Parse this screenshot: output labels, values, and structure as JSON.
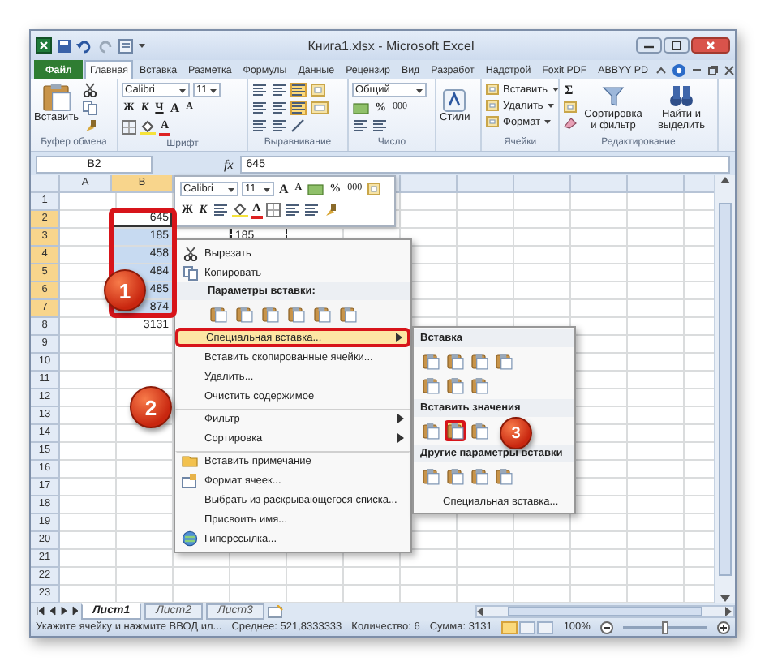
{
  "window": {
    "title": "Книга1.xlsx - Microsoft Excel"
  },
  "ribbon_tabs": [
    {
      "label": "Файл",
      "kind": "file",
      "selected": false
    },
    {
      "label": "Главная",
      "kind": "tab",
      "selected": true
    },
    {
      "label": "Вставка",
      "kind": "tab",
      "selected": false
    },
    {
      "label": "Разметка",
      "kind": "tab",
      "selected": false
    },
    {
      "label": "Формулы",
      "kind": "tab",
      "selected": false
    },
    {
      "label": "Данные",
      "kind": "tab",
      "selected": false
    },
    {
      "label": "Рецензир",
      "kind": "tab",
      "selected": false
    },
    {
      "label": "Вид",
      "kind": "tab",
      "selected": false
    },
    {
      "label": "Разработ",
      "kind": "tab",
      "selected": false
    },
    {
      "label": "Надстрой",
      "kind": "tab",
      "selected": false
    },
    {
      "label": "Foxit PDF",
      "kind": "tab",
      "selected": false
    },
    {
      "label": "ABBYY PD",
      "kind": "tab",
      "selected": false
    }
  ],
  "ribbon_groups": [
    {
      "kind": "clipboard",
      "label": "Буфер обмена",
      "paste_label": "Вставить"
    },
    {
      "kind": "font",
      "label": "Шрифт",
      "font": "Calibri",
      "size": "11",
      "style_buttons": [
        "Ж",
        "К",
        "Ч"
      ],
      "size_buttons": [
        "A",
        "A"
      ],
      "color_button": "A"
    },
    {
      "kind": "alignment",
      "label": "Выравнивание",
      "align_buttons": [
        {
          "selected": false
        },
        {
          "selected": false
        },
        {
          "selected": true
        },
        {
          "selected": false
        },
        {
          "selected": false
        },
        {
          "selected": true
        }
      ]
    },
    {
      "kind": "number",
      "label": "Число",
      "format": "Общий",
      "percent": "%",
      "thousands": "000"
    },
    {
      "kind": "styles",
      "button_label": "Стили"
    },
    {
      "kind": "cells",
      "label": "Ячейки",
      "buttons": [
        "Вставить",
        "Удалить",
        "Формат"
      ]
    },
    {
      "kind": "editing",
      "label": "Редактирование",
      "sigma": "Σ",
      "buttons": [
        "Сортировка и фильтр",
        "Найти и выделить"
      ]
    }
  ],
  "formula_bar": {
    "name_box": "B2",
    "function_label": "fx",
    "value": "645"
  },
  "column_headers": [
    {
      "label": "A",
      "selected": false
    },
    {
      "label": "B",
      "selected": true
    }
  ],
  "rows": [
    {
      "label": "1",
      "selected": false,
      "active": false
    },
    {
      "label": "2",
      "selected": true,
      "active": true,
      "column_b": "645"
    },
    {
      "label": "3",
      "selected": true,
      "active": false,
      "column_b": "185",
      "column_d": {
        "value": "185",
        "copied": true
      }
    },
    {
      "label": "4",
      "selected": true,
      "active": false,
      "column_b": "458"
    },
    {
      "label": "5",
      "selected": true,
      "active": false,
      "column_b": "484"
    },
    {
      "label": "6",
      "selected": true,
      "active": false,
      "column_b": "485"
    },
    {
      "label": "7",
      "selected": true,
      "active": false,
      "column_b": "874"
    },
    {
      "label": "8",
      "selected": false,
      "active": false,
      "column_b": "3131"
    },
    {
      "label": "9",
      "selected": false,
      "active": false
    },
    {
      "label": "10",
      "selected": false,
      "active": false
    },
    {
      "label": "11",
      "selected": false,
      "active": false
    },
    {
      "label": "12",
      "selected": false,
      "active": false
    },
    {
      "label": "13",
      "selected": false,
      "active": false
    },
    {
      "label": "14",
      "selected": false,
      "active": false
    },
    {
      "label": "15",
      "selected": false,
      "active": false
    },
    {
      "label": "16",
      "selected": false,
      "active": false
    },
    {
      "label": "17",
      "selected": false,
      "active": false
    },
    {
      "label": "18",
      "selected": false,
      "active": false
    },
    {
      "label": "19",
      "selected": false,
      "active": false
    },
    {
      "label": "20",
      "selected": false,
      "active": false
    },
    {
      "label": "21",
      "selected": false,
      "active": false
    },
    {
      "label": "22",
      "selected": false,
      "active": false
    },
    {
      "label": "23",
      "selected": false,
      "active": false
    }
  ],
  "sheet_tabs": [
    {
      "label": "Лист1",
      "selected": true
    },
    {
      "label": "Лист2",
      "selected": false
    },
    {
      "label": "Лист3",
      "selected": false
    }
  ],
  "status_bar": {
    "message": "Укажите ячейку и нажмите ВВОД ил...",
    "average": "Среднее: 521,8333333",
    "count": "Количество: 6",
    "sum": "Сумма: 3131",
    "views": [
      {
        "selected": true
      },
      {
        "selected": false
      },
      {
        "selected": false
      }
    ],
    "zoom": "100%",
    "zoom_slider": {
      "level": 0.5
    }
  },
  "mini_toolbar": {
    "font": "Calibri",
    "size": "11",
    "size_buttons": [
      "A",
      "A"
    ],
    "percent": "%",
    "thousands": "000",
    "style_buttons": [
      "Ж",
      "К"
    ],
    "color_button": "A"
  },
  "context_menu": {
    "items": [
      {
        "kind": "cut",
        "label": "Вырезать",
        "selected": false,
        "submenu": false,
        "separator_before": false
      },
      {
        "kind": "copy",
        "label": "Копировать",
        "selected": false,
        "submenu": false,
        "separator_before": false
      },
      {
        "kind": "header",
        "label": "Параметры вставки:",
        "selected": false,
        "submenu": false,
        "separator_before": false
      },
      {
        "kind": "paste_options",
        "selected": false,
        "submenu": false,
        "separator_before": false
      },
      {
        "kind": "plain",
        "label": "Специальная вставка...",
        "selected": true,
        "submenu": true,
        "separator_before": false
      },
      {
        "kind": "plain",
        "label": "Вставить скопированные ячейки...",
        "selected": false,
        "submenu": false,
        "separator_before": false
      },
      {
        "kind": "plain",
        "label": "Удалить...",
        "selected": false,
        "submenu": false,
        "separator_before": false
      },
      {
        "kind": "plain",
        "label": "Очистить содержимое",
        "selected": false,
        "submenu": false,
        "separator_before": false
      },
      {
        "kind": "plain",
        "label": "Фильтр",
        "selected": false,
        "submenu": true,
        "separator_before": true
      },
      {
        "kind": "plain",
        "label": "Сортировка",
        "selected": false,
        "submenu": true,
        "separator_before": false
      },
      {
        "kind": "comment",
        "label": "Вставить примечание",
        "selected": false,
        "submenu": false,
        "separator_before": true
      },
      {
        "kind": "format",
        "label": "Формат ячеек...",
        "selected": false,
        "submenu": false,
        "separator_before": false
      },
      {
        "kind": "plain",
        "label": "Выбрать из раскрывающегося списка...",
        "selected": false,
        "submenu": false,
        "separator_before": false
      },
      {
        "kind": "plain",
        "label": "Присвоить имя...",
        "selected": false,
        "submenu": false,
        "separator_before": false
      },
      {
        "kind": "link",
        "label": "Гиперссылка...",
        "selected": false,
        "submenu": false,
        "separator_before": false
      }
    ]
  },
  "paste_submenu": {
    "sections": [
      {
        "title": "Вставка",
        "icons": [
          {
            "selected": false
          },
          {
            "selected": false
          },
          {
            "selected": false
          },
          {
            "selected": false
          },
          {
            "selected": false
          },
          {
            "selected": false
          },
          {
            "selected": false
          }
        ]
      },
      {
        "title": "Вставить значения",
        "icons": [
          {
            "selected": false
          },
          {
            "selected": true
          },
          {
            "selected": false
          }
        ]
      },
      {
        "title": "Другие параметры вставки",
        "icons": [
          {
            "selected": false
          },
          {
            "selected": false
          },
          {
            "selected": false
          },
          {
            "selected": false
          }
        ]
      }
    ],
    "footer": "Специальная вставка..."
  },
  "callouts": [
    {
      "label": "1"
    },
    {
      "label": "2"
    },
    {
      "label": "3"
    }
  ]
}
